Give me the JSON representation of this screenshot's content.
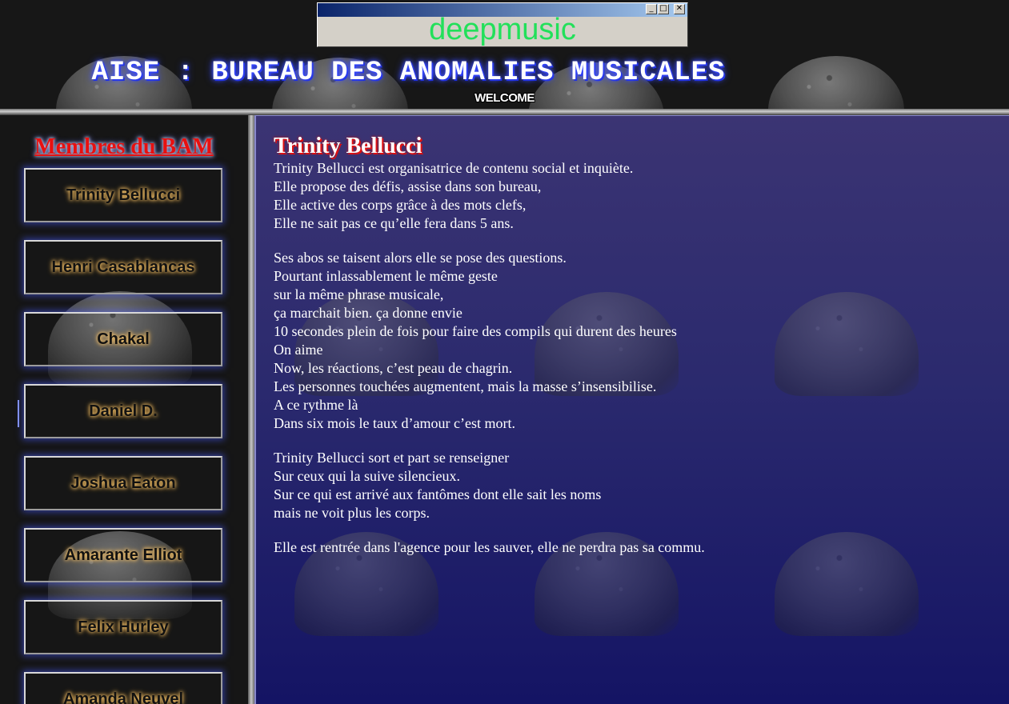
{
  "popup": {
    "text": "deepmusic",
    "buttons": [
      "minimize",
      "maximize",
      "close"
    ]
  },
  "header": {
    "title": "AISE : BUREAU DES ANOMALIES MUSICALES",
    "welcome": "WELCOME"
  },
  "sidebar": {
    "title": "Membres du BAM",
    "members": [
      "Trinity Bellucci",
      "Henri Casablancas",
      "Chakal",
      "Daniel D.",
      "Joshua Eaton",
      "Amarante Elliot",
      "Felix Hurley",
      "Amanda Neuvel"
    ]
  },
  "content": {
    "title": "Trinity Bellucci",
    "stanzas": [
      [
        "Trinity Bellucci est organisatrice de contenu social et inquiète.",
        "Elle propose des défis, assise dans son bureau,",
        "Elle active des corps grâce à des mots clefs,",
        "Elle ne sait pas ce qu’elle fera dans 5 ans."
      ],
      [
        "Ses abos se taisent alors elle se pose des questions.",
        "Pourtant inlassablement le même geste",
        "sur la même phrase musicale,",
        "ça marchait bien. ça donne envie",
        "10 secondes plein de fois pour faire des compils qui durent des heures",
        "On aime",
        "Now, les réactions, c’est peau de chagrin.",
        "Les personnes touchées augmentent, mais la masse s’insensibilise.",
        "A ce rythme là",
        "Dans six mois le taux d’amour c’est mort."
      ],
      [
        "Trinity Bellucci sort et part se renseigner",
        "Sur ceux qui la suive silencieux.",
        "Sur ce qui est arrivé aux fantômes dont elle sait les noms",
        "mais ne voit plus les corps."
      ],
      [
        "Elle est rentrée dans l'agence pour les sauver, elle ne perdra pas sa commu."
      ]
    ]
  }
}
